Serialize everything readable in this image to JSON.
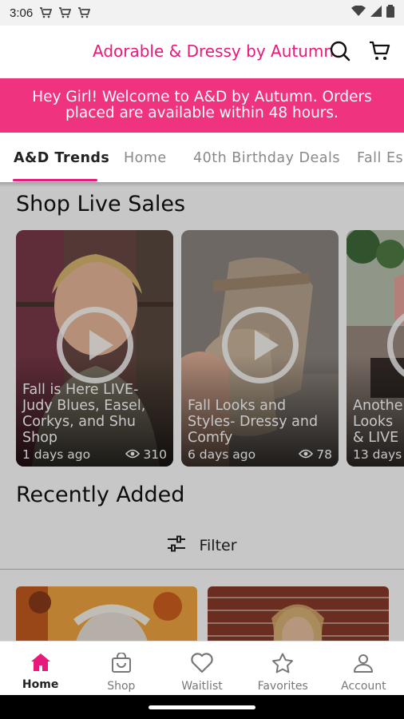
{
  "status_bar": {
    "time": "3:06"
  },
  "header": {
    "store_title": "Adorable & Dressy by Autumn"
  },
  "banner": {
    "line1": "Hey Girl! Welcome to A&D by Autumn.  Orders",
    "line2": "placed are available within 48 hours."
  },
  "tabs": [
    {
      "label": "A&D Trends"
    },
    {
      "label": "Home"
    },
    {
      "label": "40th Birthday Deals"
    },
    {
      "label": "Fall Es"
    }
  ],
  "live_sales": {
    "title": "Shop Live Sales",
    "videos": [
      {
        "title": "Fall is Here LIVE- Judy Blues, Easel, Corkys, and Shu Shop",
        "age": "1 days ago",
        "views": "310"
      },
      {
        "title": "Fall Looks and Styles- Dressy and Comfy",
        "age": "6 days ago",
        "views": "78"
      },
      {
        "title": "Another Looks & LIVE",
        "age": "13 days",
        "views": ""
      }
    ]
  },
  "recently_added": {
    "title": "Recently Added",
    "filter_label": "Filter"
  },
  "bottom_nav": [
    {
      "label": "Home",
      "icon": "home-icon"
    },
    {
      "label": "Shop",
      "icon": "shopping-bag-icon"
    },
    {
      "label": "Waitlist",
      "icon": "heart-icon"
    },
    {
      "label": "Favorites",
      "icon": "star-icon"
    },
    {
      "label": "Account",
      "icon": "person-icon"
    }
  ],
  "colors": {
    "brand_pink": "#e8197a",
    "banner_pink": "#f0337e"
  }
}
